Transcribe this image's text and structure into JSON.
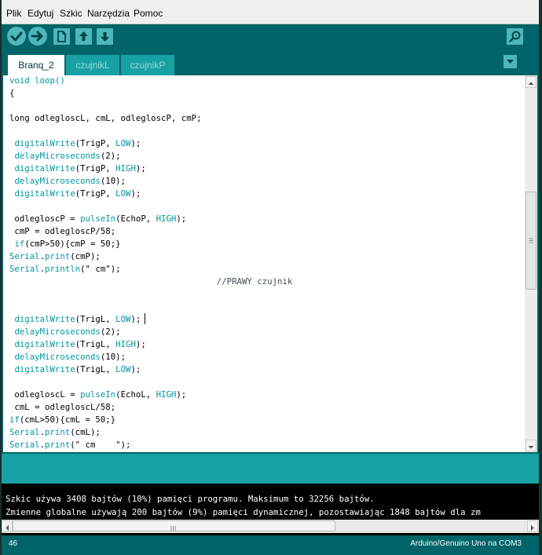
{
  "menu": [
    "Plik",
    "Edytuj",
    "Szkic",
    "Narzędzia",
    "Pomoc"
  ],
  "toolbar": {
    "buttons": [
      "verify-icon",
      "upload-icon",
      "new-icon",
      "open-icon",
      "save-icon"
    ],
    "serial_monitor": "serial-monitor-icon"
  },
  "tabs": [
    "Branq_2",
    "czujnikL",
    "czujnikP"
  ],
  "active_tab": "Branq_2",
  "editor": {
    "lines": [
      [
        [
          "void loop()",
          "k"
        ]
      ],
      [
        [
          "{",
          "t"
        ]
      ],
      [],
      [
        [
          "long odlegloscL, cmL, odlegloscP, cmP;",
          "t"
        ]
      ],
      [],
      [
        [
          " ",
          "t"
        ],
        [
          "digitalWrite",
          "k"
        ],
        [
          "(TrigP, ",
          "t"
        ],
        [
          "LOW",
          "k"
        ],
        [
          ");",
          "t"
        ]
      ],
      [
        [
          " ",
          "t"
        ],
        [
          "delayMicroseconds",
          "k"
        ],
        [
          "(2);",
          "t"
        ]
      ],
      [
        [
          " ",
          "t"
        ],
        [
          "digitalWrite",
          "k"
        ],
        [
          "(TrigP, ",
          "t"
        ],
        [
          "HIGH",
          "k"
        ],
        [
          ");",
          "t"
        ]
      ],
      [
        [
          " ",
          "t"
        ],
        [
          "delayMicroseconds",
          "k"
        ],
        [
          "(10);",
          "t"
        ]
      ],
      [
        [
          " ",
          "t"
        ],
        [
          "digitalWrite",
          "k"
        ],
        [
          "(TrigP, ",
          "t"
        ],
        [
          "LOW",
          "k"
        ],
        [
          ");",
          "t"
        ]
      ],
      [],
      [
        [
          " odlegloscP = ",
          "t"
        ],
        [
          "pulseIn",
          "k"
        ],
        [
          "(EchoP, ",
          "t"
        ],
        [
          "HIGH",
          "k"
        ],
        [
          ");",
          "t"
        ]
      ],
      [
        [
          " cmP = odlegloscP/58;",
          "t"
        ]
      ],
      [
        [
          " ",
          "t"
        ],
        [
          "if",
          "k"
        ],
        [
          "(cmP>50){cmP = 50;}",
          "t"
        ]
      ],
      [
        [
          "Serial",
          "k"
        ],
        [
          ".",
          "t"
        ],
        [
          "print",
          "k"
        ],
        [
          "(cmP);",
          "t"
        ]
      ],
      [
        [
          "Serial",
          "k"
        ],
        [
          ".",
          "t"
        ],
        [
          "println",
          "k"
        ],
        [
          "(\" cm\");",
          "t"
        ]
      ],
      [
        [
          "                                         //PRAWY czujnik",
          "c"
        ]
      ],
      [],
      [],
      [
        [
          " ",
          "t"
        ],
        [
          "digitalWrite",
          "k"
        ],
        [
          "(TrigL, ",
          "t"
        ],
        [
          "LOW",
          "k"
        ],
        [
          ");",
          "t"
        ]
      ],
      [
        [
          " ",
          "t"
        ],
        [
          "delayMicroseconds",
          "k"
        ],
        [
          "(2);",
          "t"
        ]
      ],
      [
        [
          " ",
          "t"
        ],
        [
          "digitalWrite",
          "k"
        ],
        [
          "(TrigL, ",
          "t"
        ],
        [
          "HIGH",
          "k"
        ],
        [
          ");",
          "t"
        ]
      ],
      [
        [
          " ",
          "t"
        ],
        [
          "delayMicroseconds",
          "k"
        ],
        [
          "(10);",
          "t"
        ]
      ],
      [
        [
          " ",
          "t"
        ],
        [
          "digitalWrite",
          "k"
        ],
        [
          "(TrigL, ",
          "t"
        ],
        [
          "LOW",
          "k"
        ],
        [
          ");",
          "t"
        ]
      ],
      [],
      [
        [
          " odlegloscL = ",
          "t"
        ],
        [
          "pulseIn",
          "k"
        ],
        [
          "(EchoL, ",
          "t"
        ],
        [
          "HIGH",
          "k"
        ],
        [
          ");",
          "t"
        ]
      ],
      [
        [
          " cmL = odlegloscL/58;",
          "t"
        ]
      ],
      [
        [
          "if",
          "k"
        ],
        [
          "(cmL>50){cmL = 50;}",
          "t"
        ]
      ],
      [
        [
          "Serial",
          "k"
        ],
        [
          ".",
          "t"
        ],
        [
          "print",
          "k"
        ],
        [
          "(cmL);",
          "t"
        ]
      ],
      [
        [
          "Serial",
          "k"
        ],
        [
          ".",
          "t"
        ],
        [
          "print",
          "k"
        ],
        [
          "(\" cm    \");",
          "t"
        ]
      ]
    ]
  },
  "console": {
    "lines": [
      "Szkic używa 3408 bajtów (10%) pamięci programu. Maksimum to 32256 bajtów.",
      "Zmienne globalne używają 200 bajtów (9%) pamięci dynamicznej, pozostawiając 1848 bajtów dla zm"
    ]
  },
  "status": {
    "line_number": "46",
    "board": "Arduino/Genuino Uno na COM3"
  },
  "colors": {
    "frame": "#006468",
    "tab_inactive": "#17a1a5",
    "button": "#4db7bb",
    "keyword": "#00979c",
    "console_bg": "#000000"
  }
}
